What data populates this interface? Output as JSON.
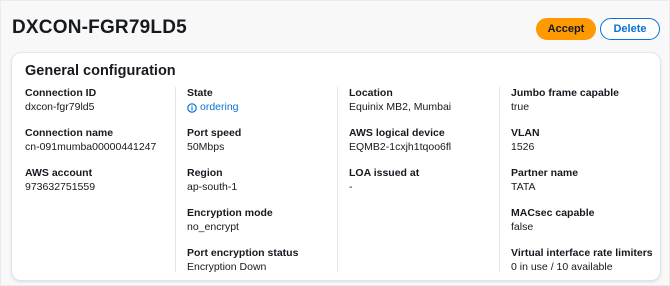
{
  "header": {
    "title": "DXCON-FGR79LD5",
    "accept_label": "Accept",
    "delete_label": "Delete"
  },
  "card": {
    "title": "General configuration",
    "col1": [
      {
        "label": "Connection ID",
        "value": "dxcon-fgr79ld5"
      },
      {
        "label": "Connection name",
        "value": "cn-091mumba00000441247"
      },
      {
        "label": "AWS account",
        "value": "973632751559"
      }
    ],
    "col2": [
      {
        "label": "State",
        "value": "ordering",
        "icon": "info-icon"
      },
      {
        "label": "Port speed",
        "value": "50Mbps"
      },
      {
        "label": "Region",
        "value": "ap-south-1"
      },
      {
        "label": "Encryption mode",
        "value": "no_encrypt"
      },
      {
        "label": "Port encryption status",
        "value": "Encryption Down"
      }
    ],
    "col3": [
      {
        "label": "Location",
        "value": "Equinix MB2, Mumbai"
      },
      {
        "label": "AWS logical device",
        "value": "EQMB2-1cxjh1tqoo6fl"
      },
      {
        "label": "LOA issued at",
        "value": "-"
      }
    ],
    "col4": [
      {
        "label": "Jumbo frame capable",
        "value": "true"
      },
      {
        "label": "VLAN",
        "value": "1526"
      },
      {
        "label": "Partner name",
        "value": "TATA"
      },
      {
        "label": "MACsec capable",
        "value": "false"
      },
      {
        "label": "Virtual interface rate limiters",
        "value": "0 in use / 10 available"
      }
    ]
  },
  "colors": {
    "accent": "#ff9900",
    "link": "#0972d3",
    "text": "#16191f"
  }
}
